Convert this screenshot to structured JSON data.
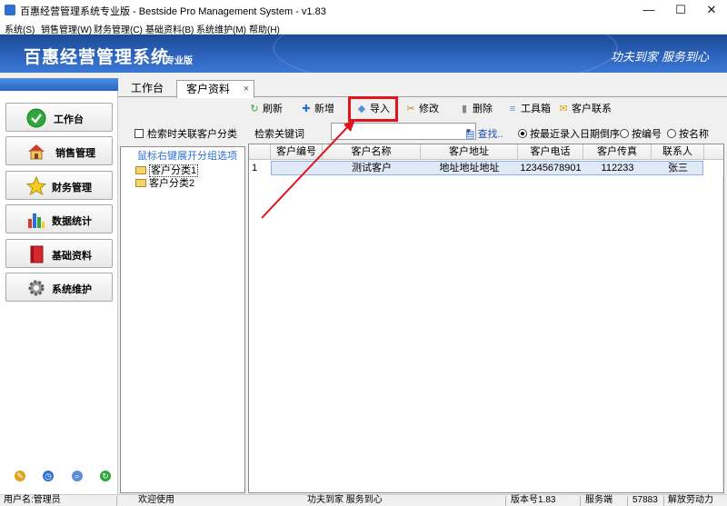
{
  "window": {
    "title": "百惠经营管理系统专业版 - Bestside Pro Management System - v1.83",
    "minimize": "—",
    "maximize": "☐",
    "close": "✕"
  },
  "menu": [
    "系统(S)",
    "销售管理(W)",
    "财务管理(C)",
    "基础资料(B)",
    "系统维护(M)",
    "帮助(H)"
  ],
  "banner": {
    "app_name": "百惠经营管理系统",
    "edition": "专业版",
    "slogan": "功夫到家  服务到心"
  },
  "sidebar": {
    "items": [
      {
        "label": "工作台",
        "icon": "check-icon"
      },
      {
        "label": "销售管理",
        "icon": "house-icon"
      },
      {
        "label": "财务管理",
        "icon": "star-icon"
      },
      {
        "label": "数据统计",
        "icon": "bar-chart-icon"
      },
      {
        "label": "基础资料",
        "icon": "book-icon"
      },
      {
        "label": "系统维护",
        "icon": "gear-icon"
      }
    ],
    "bottom_icons": [
      "pencil-icon",
      "clock-icon",
      "search-icon",
      "refresh-icon"
    ]
  },
  "tabs": [
    {
      "label": "工作台",
      "active": false
    },
    {
      "label": "客户资料",
      "active": true,
      "close": "×"
    }
  ],
  "toolbar": {
    "refresh": "刷新",
    "add": "新增",
    "import": "导入",
    "edit": "修改",
    "delete": "删除",
    "tools": "工具箱",
    "contact": "客户联系"
  },
  "left_panel": {
    "checkbox_label": "检索时关联客户分类",
    "tree_hint": "鼠标右键展开分组选项",
    "nodes": [
      "客户分类1",
      "客户分类2"
    ]
  },
  "search": {
    "label": "检索关键词",
    "value": "",
    "find": "查找..",
    "radios": [
      {
        "label": "按最近录入日期倒序",
        "checked": true
      },
      {
        "label": "按编号",
        "checked": false
      },
      {
        "label": "按名称",
        "checked": false
      }
    ]
  },
  "grid": {
    "columns": [
      "客户编号",
      "客户名称",
      "客户地址",
      "客户电话",
      "客户传真",
      "联系人"
    ],
    "rows": [
      {
        "index": "1",
        "cells": [
          "",
          "测试客户",
          "地址地址地址",
          "12345678901",
          "112233",
          "张三"
        ]
      }
    ]
  },
  "status": {
    "user": "用户名:管理员",
    "welcome": "欢迎使用",
    "slogan": "功夫到家 服务到心",
    "version": "版本号1.83",
    "server": "服务端",
    "code": "57883",
    "company": "解放劳动力"
  },
  "colors": {
    "banner": "#2f66c0",
    "highlight": "#e1141b",
    "link": "#1b4fb8"
  }
}
